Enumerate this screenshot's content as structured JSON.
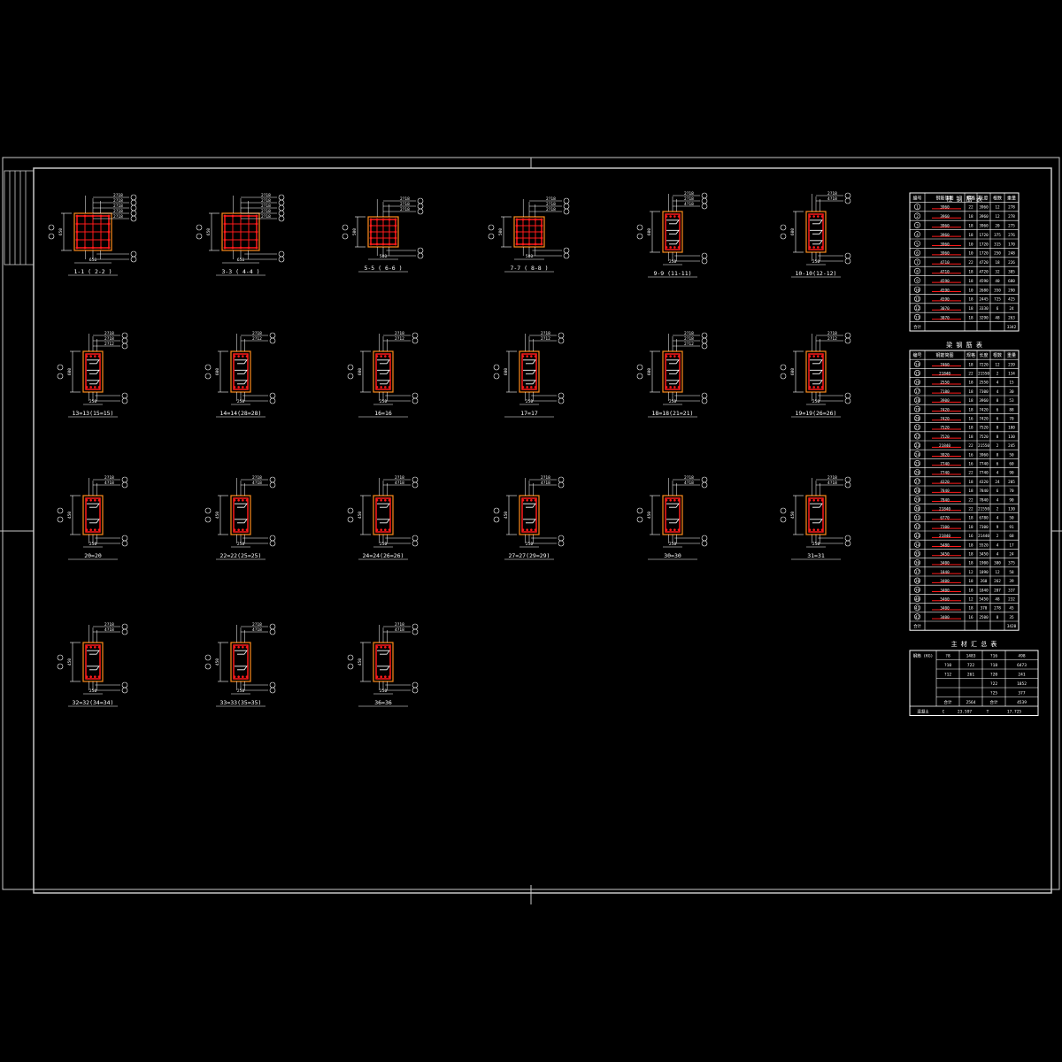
{
  "sheet": {
    "colors": {
      "background": "#000000",
      "frame": "#c8c8c8",
      "line": "#ffffff",
      "concrete": "#ff8c1a",
      "rebar": "#ff1a1a",
      "table_line": "#ffffff"
    }
  },
  "sections": [
    {
      "label": "1-1 ( 2-2 )",
      "kind": "square",
      "dims": {
        "h": "650",
        "w": "650"
      },
      "callouts": [
        "2?18",
        "2?18",
        "2?18",
        "2?18",
        "2?18"
      ]
    },
    {
      "label": "3-3 ( 4-4 )",
      "kind": "square",
      "dims": {
        "h": "650",
        "w": "650"
      },
      "callouts": [
        "2?18",
        "2?18",
        "2?18",
        "2?18",
        "2?18"
      ]
    },
    {
      "label": "5-5 ( 6-6 )",
      "kind": "square-sm",
      "dims": {
        "h": "500",
        "w": "500"
      },
      "callouts": [
        "2?18",
        "2?18",
        "2?18"
      ]
    },
    {
      "label": "7-7 ( 8-8 )",
      "kind": "square-sm",
      "dims": {
        "h": "500",
        "w": "500"
      },
      "callouts": [
        "2?18",
        "2?18",
        "2?18"
      ]
    },
    {
      "label": "9-9 (11-11)",
      "kind": "beam",
      "dims": {
        "h": "600",
        "w": "250"
      },
      "callouts": [
        "2?18",
        "2?18",
        "4?18"
      ]
    },
    {
      "label": "10-10(12-12)",
      "kind": "beam",
      "dims": {
        "h": "600",
        "w": "250"
      },
      "callouts": [
        "2?18",
        "4?18"
      ]
    },
    {
      "label": "13=13(15=15)",
      "kind": "beam",
      "dims": {
        "h": "600",
        "w": "250"
      },
      "callouts": [
        "2?18",
        "2?18",
        "2?12"
      ]
    },
    {
      "label": "14=14(28=28)",
      "kind": "beam",
      "dims": {
        "h": "600",
        "w": "250"
      },
      "callouts": [
        "2?18",
        "2?12"
      ]
    },
    {
      "label": "16=16",
      "kind": "beam",
      "dims": {
        "h": "600",
        "w": "250"
      },
      "callouts": [
        "2?18",
        "2?12"
      ]
    },
    {
      "label": "17=17",
      "kind": "beam",
      "dims": {
        "h": "600",
        "w": "250"
      },
      "callouts": [
        "2?18",
        "2?12"
      ]
    },
    {
      "label": "18=18(21=21)",
      "kind": "beam",
      "dims": {
        "h": "600",
        "w": "250"
      },
      "callouts": [
        "2?18",
        "2?18",
        "2?12"
      ]
    },
    {
      "label": "19=19(26=26)",
      "kind": "beam",
      "dims": {
        "h": "600",
        "w": "250"
      },
      "callouts": [
        "2?18",
        "2?12"
      ]
    },
    {
      "label": "20=20",
      "kind": "beam-s",
      "dims": {
        "h": "450",
        "w": "250"
      },
      "callouts": [
        "2?18",
        "4?18"
      ]
    },
    {
      "label": "22=22(25=25)",
      "kind": "beam-s",
      "dims": {
        "h": "450",
        "w": "250"
      },
      "callouts": [
        "2?18",
        "4?18"
      ]
    },
    {
      "label": "24=24(26=26)",
      "kind": "beam-s",
      "dims": {
        "h": "450",
        "w": "250"
      },
      "callouts": [
        "2?18",
        "4?18"
      ]
    },
    {
      "label": "27=27(29=29)",
      "kind": "beam-s",
      "dims": {
        "h": "450",
        "w": "250"
      },
      "callouts": [
        "2?18",
        "4?18"
      ]
    },
    {
      "label": "30=30",
      "kind": "beam-s",
      "dims": {
        "h": "450",
        "w": "250"
      },
      "callouts": [
        "2?18",
        "4?18"
      ]
    },
    {
      "label": "31=31",
      "kind": "beam-s",
      "dims": {
        "h": "450",
        "w": "250"
      },
      "callouts": [
        "2?18",
        "4?18"
      ]
    },
    {
      "label": "32=32(34=34)",
      "kind": "beam-s",
      "dims": {
        "h": "450",
        "w": "250"
      },
      "callouts": [
        "2?18",
        "4?18"
      ]
    },
    {
      "label": "33=33(35=35)",
      "kind": "beam-s",
      "dims": {
        "h": "450",
        "w": "250"
      },
      "callouts": [
        "2?18",
        "4?18"
      ]
    },
    {
      "label": "36=36",
      "kind": "beam-s",
      "dims": {
        "h": "450",
        "w": "250"
      },
      "callouts": [
        "2?18",
        "4?18"
      ]
    }
  ],
  "table1": {
    "title": "柱 钢 筋 表",
    "headers": [
      "编号",
      "钢筋简图",
      "规格",
      "长度",
      "根数",
      "重量"
    ],
    "rows": [
      [
        "1",
        "3960",
        "22",
        "3960",
        "12",
        "278"
      ],
      [
        "2",
        "3960",
        "18",
        "3960",
        "12",
        "278"
      ],
      [
        "3",
        "3960",
        "18",
        "3960",
        "20",
        "275"
      ],
      [
        "4",
        "3960",
        "18",
        "1720",
        "375",
        "276"
      ],
      [
        "5",
        "3960",
        "10",
        "1720",
        "315",
        "170"
      ],
      [
        "6",
        "3960",
        "10",
        "1720",
        "250",
        "248"
      ],
      [
        "7",
        "4710",
        "22",
        "4720",
        "18",
        "226"
      ],
      [
        "8",
        "4710",
        "18",
        "4720",
        "32",
        "305"
      ],
      [
        "9",
        "4590",
        "18",
        "4590",
        "40",
        "680"
      ],
      [
        "10",
        "4590",
        "10",
        "2680",
        "350",
        "290"
      ],
      [
        "11",
        "4590",
        "18",
        "2445",
        "725",
        "425"
      ],
      [
        "12",
        "3070",
        "18",
        "3330",
        "6",
        "24"
      ],
      [
        "13",
        "3070",
        "18",
        "3290",
        "48",
        "263"
      ],
      [
        "合计",
        "",
        "",
        "",
        "",
        "3342"
      ]
    ]
  },
  "table2": {
    "title": "梁 钢 筋 表",
    "headers": [
      "编号",
      "钢筋简图",
      "规格",
      "长度",
      "根数",
      "重量"
    ],
    "rows": [
      [
        "14",
        "7460",
        "18",
        "7220",
        "12",
        "239"
      ],
      [
        "15",
        "21840",
        "22",
        "21550",
        "2",
        "134"
      ],
      [
        "16",
        "2550",
        "18",
        "2550",
        "4",
        "15"
      ],
      [
        "17",
        "7180",
        "18",
        "7300",
        "4",
        "30"
      ],
      [
        "18",
        "3900",
        "18",
        "3960",
        "8",
        "53"
      ],
      [
        "19",
        "7420",
        "18",
        "7420",
        "6",
        "88"
      ],
      [
        "20",
        "7420",
        "16",
        "7420",
        "6",
        "70"
      ],
      [
        "21",
        "7520",
        "18",
        "7520",
        "8",
        "100"
      ],
      [
        "22",
        "7520",
        "18",
        "7520",
        "8",
        "130"
      ],
      [
        "23",
        "21840",
        "22",
        "21550",
        "2",
        "245"
      ],
      [
        "24",
        "3920",
        "16",
        "3960",
        "8",
        "50"
      ],
      [
        "25",
        "7740",
        "16",
        "7740",
        "6",
        "60"
      ],
      [
        "26",
        "7740",
        "22",
        "7740",
        "4",
        "90"
      ],
      [
        "27",
        "4320",
        "18",
        "4320",
        "24",
        "205"
      ],
      [
        "28",
        "7840",
        "18",
        "7840",
        "6",
        "70"
      ],
      [
        "29",
        "7840",
        "22",
        "7840",
        "4",
        "90"
      ],
      [
        "30",
        "21840",
        "22",
        "21550",
        "2",
        "130"
      ],
      [
        "31",
        "6770",
        "18",
        "6780",
        "4",
        "50"
      ],
      [
        "32",
        "7300",
        "18",
        "7300",
        "9",
        "91"
      ],
      [
        "33",
        "21840",
        "16",
        "21440",
        "2",
        "68"
      ],
      [
        "34",
        "5480",
        "18",
        "5520",
        "4",
        "17"
      ],
      [
        "35",
        "3450",
        "18",
        "3450",
        "4",
        "24"
      ],
      [
        "36",
        "3400",
        "18",
        "1900",
        "300",
        "375"
      ],
      [
        "37",
        "1840",
        "12",
        "1890",
        "12",
        "58"
      ],
      [
        "38",
        "3400",
        "18",
        "260",
        "262",
        "39"
      ],
      [
        "39",
        "3400",
        "18",
        "1840",
        "207",
        "337"
      ],
      [
        "40",
        "5460",
        "12",
        "5450",
        "48",
        "232"
      ],
      [
        "41",
        "3400",
        "18",
        "370",
        "278",
        "45"
      ],
      [
        "42",
        "3400",
        "16",
        "2500",
        "8",
        "35"
      ],
      [
        "合计",
        "",
        "",
        "",
        "",
        "3420"
      ]
    ]
  },
  "table3": {
    "title": "主 材 汇 总 表",
    "rows": [
      [
        "钢筋 (KG)",
        "?8",
        "1483",
        "?16",
        "498"
      ],
      [
        "",
        "?10",
        "722",
        "?18",
        "6473"
      ],
      [
        "",
        "?12",
        "261",
        "?20",
        "241"
      ],
      [
        "",
        "",
        "",
        "?22",
        "1852"
      ],
      [
        "",
        "",
        "",
        "?25",
        "377"
      ],
      [
        "",
        "合计",
        "2564",
        "合计",
        "4539"
      ]
    ],
    "footer": [
      "混凝土",
      "C",
      "23.597",
      "T",
      "17.725"
    ]
  }
}
